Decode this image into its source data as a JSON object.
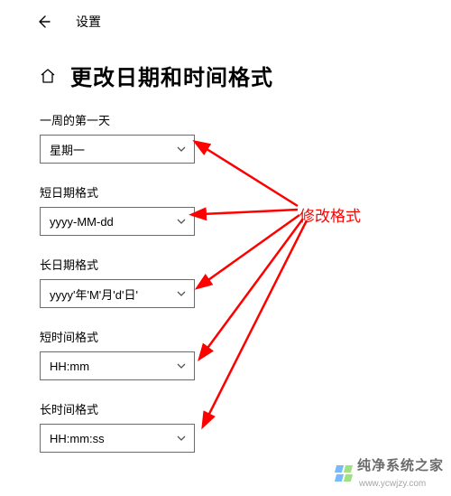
{
  "topbar": {
    "title": "设置"
  },
  "header": {
    "title": "更改日期和时间格式"
  },
  "fields": {
    "first_day": {
      "label": "一周的第一天",
      "value": "星期一"
    },
    "short_date": {
      "label": "短日期格式",
      "value": "yyyy-MM-dd"
    },
    "long_date": {
      "label": "长日期格式",
      "value": "yyyy'年'M'月'd'日'"
    },
    "short_time": {
      "label": "短时间格式",
      "value": "HH:mm"
    },
    "long_time": {
      "label": "长时间格式",
      "value": "HH:mm:ss"
    }
  },
  "annotation": {
    "label": "修改格式",
    "color": "#ff0000"
  },
  "watermark": {
    "text": "纯净系统之家",
    "url": "www.ycwjzy.com"
  }
}
